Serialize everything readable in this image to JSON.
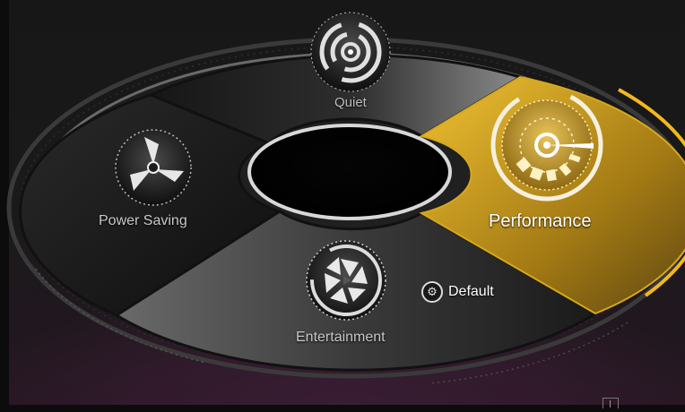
{
  "modes": {
    "quiet": {
      "label": "Quiet",
      "icon": "concentric-rings-icon",
      "selected": false
    },
    "power_saving": {
      "label": "Power Saving",
      "icon": "fan-icon",
      "selected": false
    },
    "performance": {
      "label": "Performance",
      "icon": "speedometer-gauge-icon",
      "selected": true
    },
    "entertainment": {
      "label": "Entertainment",
      "icon": "aperture-icon",
      "selected": false
    }
  },
  "default_button": {
    "label": "Default",
    "icon": "reset-gear-icon"
  },
  "colors": {
    "accent": "#f2b81c",
    "selected_segment": "#c79a1e",
    "segment_dark": "#232323",
    "segment_light": "#5a5a5a",
    "background_glow": "#3a1d33"
  }
}
